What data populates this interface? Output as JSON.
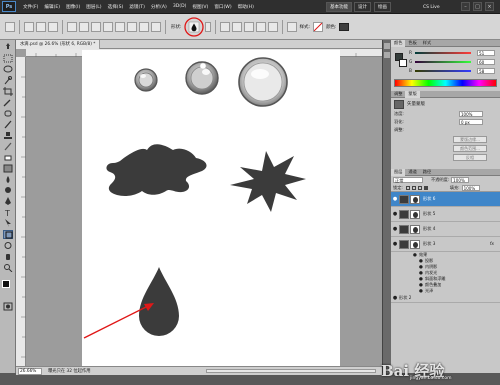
{
  "app": {
    "logo": "Ps",
    "menu": [
      "文件(F)",
      "编辑(E)",
      "图像(I)",
      "图层(L)",
      "选择(S)",
      "滤镜(T)",
      "分析(A)",
      "3D(D)",
      "视图(V)",
      "窗口(W)",
      "帮助(H)"
    ],
    "zoom_display": "26.6",
    "workspace_buttons": [
      "基本功能",
      "设计",
      "绘画"
    ],
    "cslive": "CS Live"
  },
  "options_bar": {
    "shape_label": "形状:",
    "style_label": "样式:",
    "color_label": "颜色:",
    "accent_circle_color": "#e01818"
  },
  "document": {
    "tab_title": "水滴.psd @ 26.6% (形状 6, RGB/8) *",
    "zoom": "26.66%",
    "status": "曝光只在 32 位起作用",
    "ruler_numbers": [
      "0",
      "2",
      "4",
      "6",
      "8",
      "10",
      "12",
      "14",
      "16",
      "18",
      "20",
      "22",
      "24",
      "26"
    ]
  },
  "color_panel": {
    "tabs": [
      "颜色",
      "色板",
      "样式"
    ],
    "channels": [
      {
        "name": "R",
        "value": "51"
      },
      {
        "name": "G",
        "value": "60"
      },
      {
        "name": "B",
        "value": "58"
      }
    ]
  },
  "adjust_panel": {
    "tabs": [
      "调整",
      "蒙版"
    ],
    "title": "矢量蒙版",
    "density_label": "浓度:",
    "density_value": "100%",
    "feather_label": "羽化:",
    "feather_value": "0 px",
    "refine_label": "调整:",
    "buttons": [
      "蒙版边缘...",
      "颜色范围...",
      "反相"
    ]
  },
  "layers_panel": {
    "tabs": [
      "图层",
      "通道",
      "路径"
    ],
    "blend_mode": "正常",
    "opacity_label": "不透明度:",
    "opacity_value": "100%",
    "lock_label": "锁定:",
    "fill_label": "填充:",
    "fill_value": "100%",
    "layers": [
      {
        "name": "形状 6",
        "selected": true,
        "fx": false
      },
      {
        "name": "形状 5",
        "selected": false,
        "fx": false
      },
      {
        "name": "形状 4",
        "selected": false,
        "fx": false
      },
      {
        "name": "形状 3",
        "selected": false,
        "fx": true
      }
    ],
    "effects_header": "效果",
    "effects": [
      "投影",
      "内阴影",
      "内发光",
      "斜面和浮雕",
      "颜色叠加",
      "光泽"
    ],
    "fx_symbol": "fx",
    "more_layer": "形状 2"
  },
  "watermark": {
    "text": "Bai 经验",
    "sub": "jingyan.baidu.com"
  }
}
